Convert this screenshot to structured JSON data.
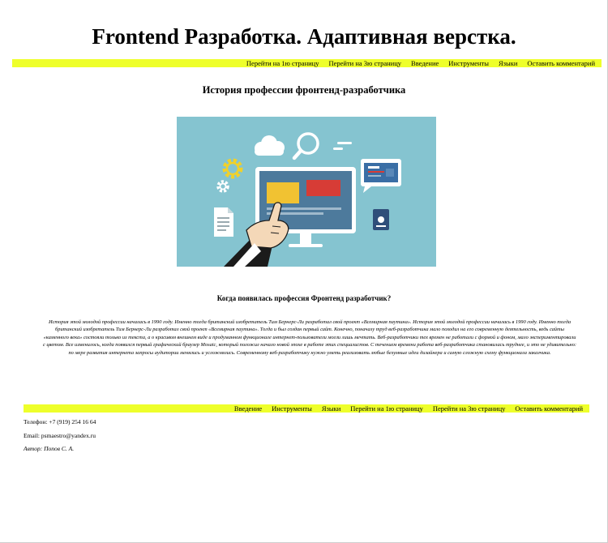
{
  "header": {
    "title": "Frontend Разработка. Адаптивная верстка."
  },
  "nav_top": {
    "items": [
      "Перейти на 1ю страницу",
      "Перейти на 3ю страницу",
      "Введение",
      "Инструменты",
      "Языки",
      "Оставить комментарий"
    ]
  },
  "main": {
    "title": "История профессии фронтенд-разработчика",
    "image": {
      "icons": [
        "cloud-icon",
        "magnifier-icon",
        "gear-icon",
        "monitor-icon",
        "pointing-hand-icon",
        "document-icon",
        "browser-window-icon",
        "passport-icon"
      ],
      "background_color": "#85c4d0"
    },
    "subtitle": "Когда появилась профессия Фронтенд разработчик?",
    "article_text": "История этой молодой профессии началась в 1990 году. Именно тогда британский изобретатель Тим Бернерс-Ли разработал свой проект «Всемирная паутина». История этой молодой профессии началась в 1990 году. Именно тогда британский изобретатель Тим Бернерс-Ли разработал свой проект «Всемирная паутина». Тогда и был создан первый сайт. Конечно, поначалу труд веб-разработчика мало походил на его современную деятельность, ведь сайты «каменного века» состояли только из текста, а о красивом внешнем виде и продуманном функционале интернет-пользователи могли лишь мечтать. Веб-разработчики тех времен не работали с формой и фоном, мало экспериментировали с цветом. Все изменилось, когда появился первый графический браузер Mosaic, который положил начало новой эпохе в работе этих специалистов. С течением времени работа веб-разработчика становилась труднее, и это не удивительно: по мере развития интернета запросы аудитории менялись и усложнялись. Современному веб-разработчику нужно уметь реализовать любые безумные идеи дизайнера и самую сложную схему функционала заказчика."
  },
  "nav_bottom": {
    "items": [
      "Введение",
      "Инструменты",
      "Языки",
      "Перейти на 1ю страницу",
      "Перейти на 3ю страницу",
      "Оставить комментарий"
    ]
  },
  "footer": {
    "phone": "Телефон: +7 (919) 254 16 64",
    "email": "Email: psmaestro@yandex.ru",
    "author": "Автор: Попов С. А."
  },
  "colors": {
    "nav_background": "#eeff2b",
    "hero_background": "#85c4d0"
  }
}
